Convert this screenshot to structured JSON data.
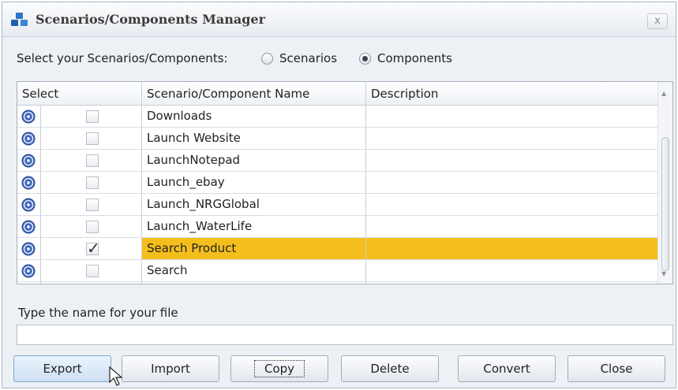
{
  "window": {
    "title": "Scenarios/Components Manager",
    "close_label": "x",
    "icon": "app-cubes-icon"
  },
  "selector": {
    "label": "Select your Scenarios/Components:",
    "options": [
      {
        "label": "Scenarios",
        "checked": false
      },
      {
        "label": "Components",
        "checked": true
      }
    ]
  },
  "table": {
    "headers": {
      "select": "Select",
      "name": "Scenario/Component Name",
      "description": "Description"
    },
    "rows": [
      {
        "name": "Downloads",
        "description": "",
        "checked": false,
        "selected": false
      },
      {
        "name": "Launch Website",
        "description": "",
        "checked": false,
        "selected": false
      },
      {
        "name": "LaunchNotepad",
        "description": "",
        "checked": false,
        "selected": false
      },
      {
        "name": "Launch_ebay",
        "description": "",
        "checked": false,
        "selected": false
      },
      {
        "name": "Launch_NRGGlobal",
        "description": "",
        "checked": false,
        "selected": false
      },
      {
        "name": "Launch_WaterLife",
        "description": "",
        "checked": false,
        "selected": false
      },
      {
        "name": "Search Product",
        "description": "",
        "checked": true,
        "selected": true
      },
      {
        "name": "Search",
        "description": "",
        "checked": false,
        "selected": false
      }
    ],
    "row_icon": "component-icon",
    "selected_color": "#f4be1d"
  },
  "file": {
    "label": "Type the name for your file",
    "value": ""
  },
  "buttons": {
    "export": "Export",
    "import": "Import",
    "copy": "Copy",
    "delete": "Delete",
    "convert": "Convert",
    "close": "Close"
  }
}
